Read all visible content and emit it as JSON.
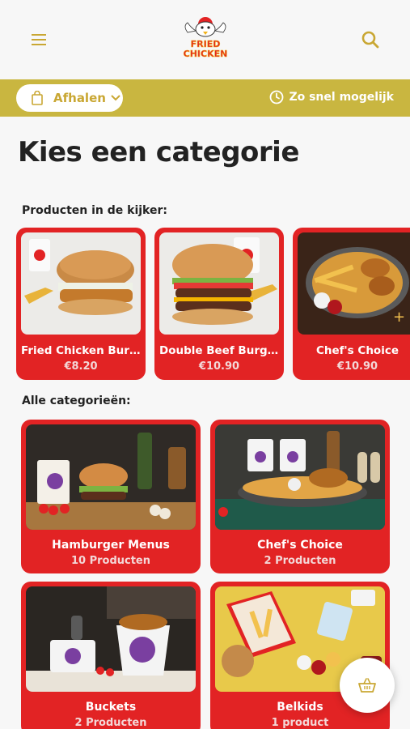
{
  "header": {
    "logo_text_top": "FRIED",
    "logo_text_bottom": "CHICKEN"
  },
  "bar": {
    "pickup_label": "Afhalen",
    "timing_label": "Zo snel mogelijk"
  },
  "page_title": "Kies een categorie",
  "featured": {
    "label": "Producten in de kijker:",
    "items": [
      {
        "name": "Fried Chicken Burger Menu",
        "price": "€8.20"
      },
      {
        "name": "Double Beef Burger Menu",
        "price": "€10.90"
      },
      {
        "name": "Chef's Choice",
        "price": "€10.90"
      }
    ]
  },
  "categories": {
    "label": "Alle categorieën:",
    "items": [
      {
        "name": "Hamburger Menus",
        "count": "10 Producten"
      },
      {
        "name": "Chef's Choice",
        "count": "2 Producten"
      },
      {
        "name": "Buckets",
        "count": "2 Producten"
      },
      {
        "name": "Belkids",
        "count": "1 product"
      }
    ]
  },
  "colors": {
    "accent_gold": "#c9b640",
    "card_red": "#e22324",
    "icon_gold": "#c9a733"
  },
  "icons": {
    "menu": "hamburger-menu-icon",
    "search": "search-icon",
    "pickup": "shopping-bag-icon",
    "dropdown": "chevron-down-icon",
    "timing": "clock-icon",
    "cart": "basket-icon"
  }
}
